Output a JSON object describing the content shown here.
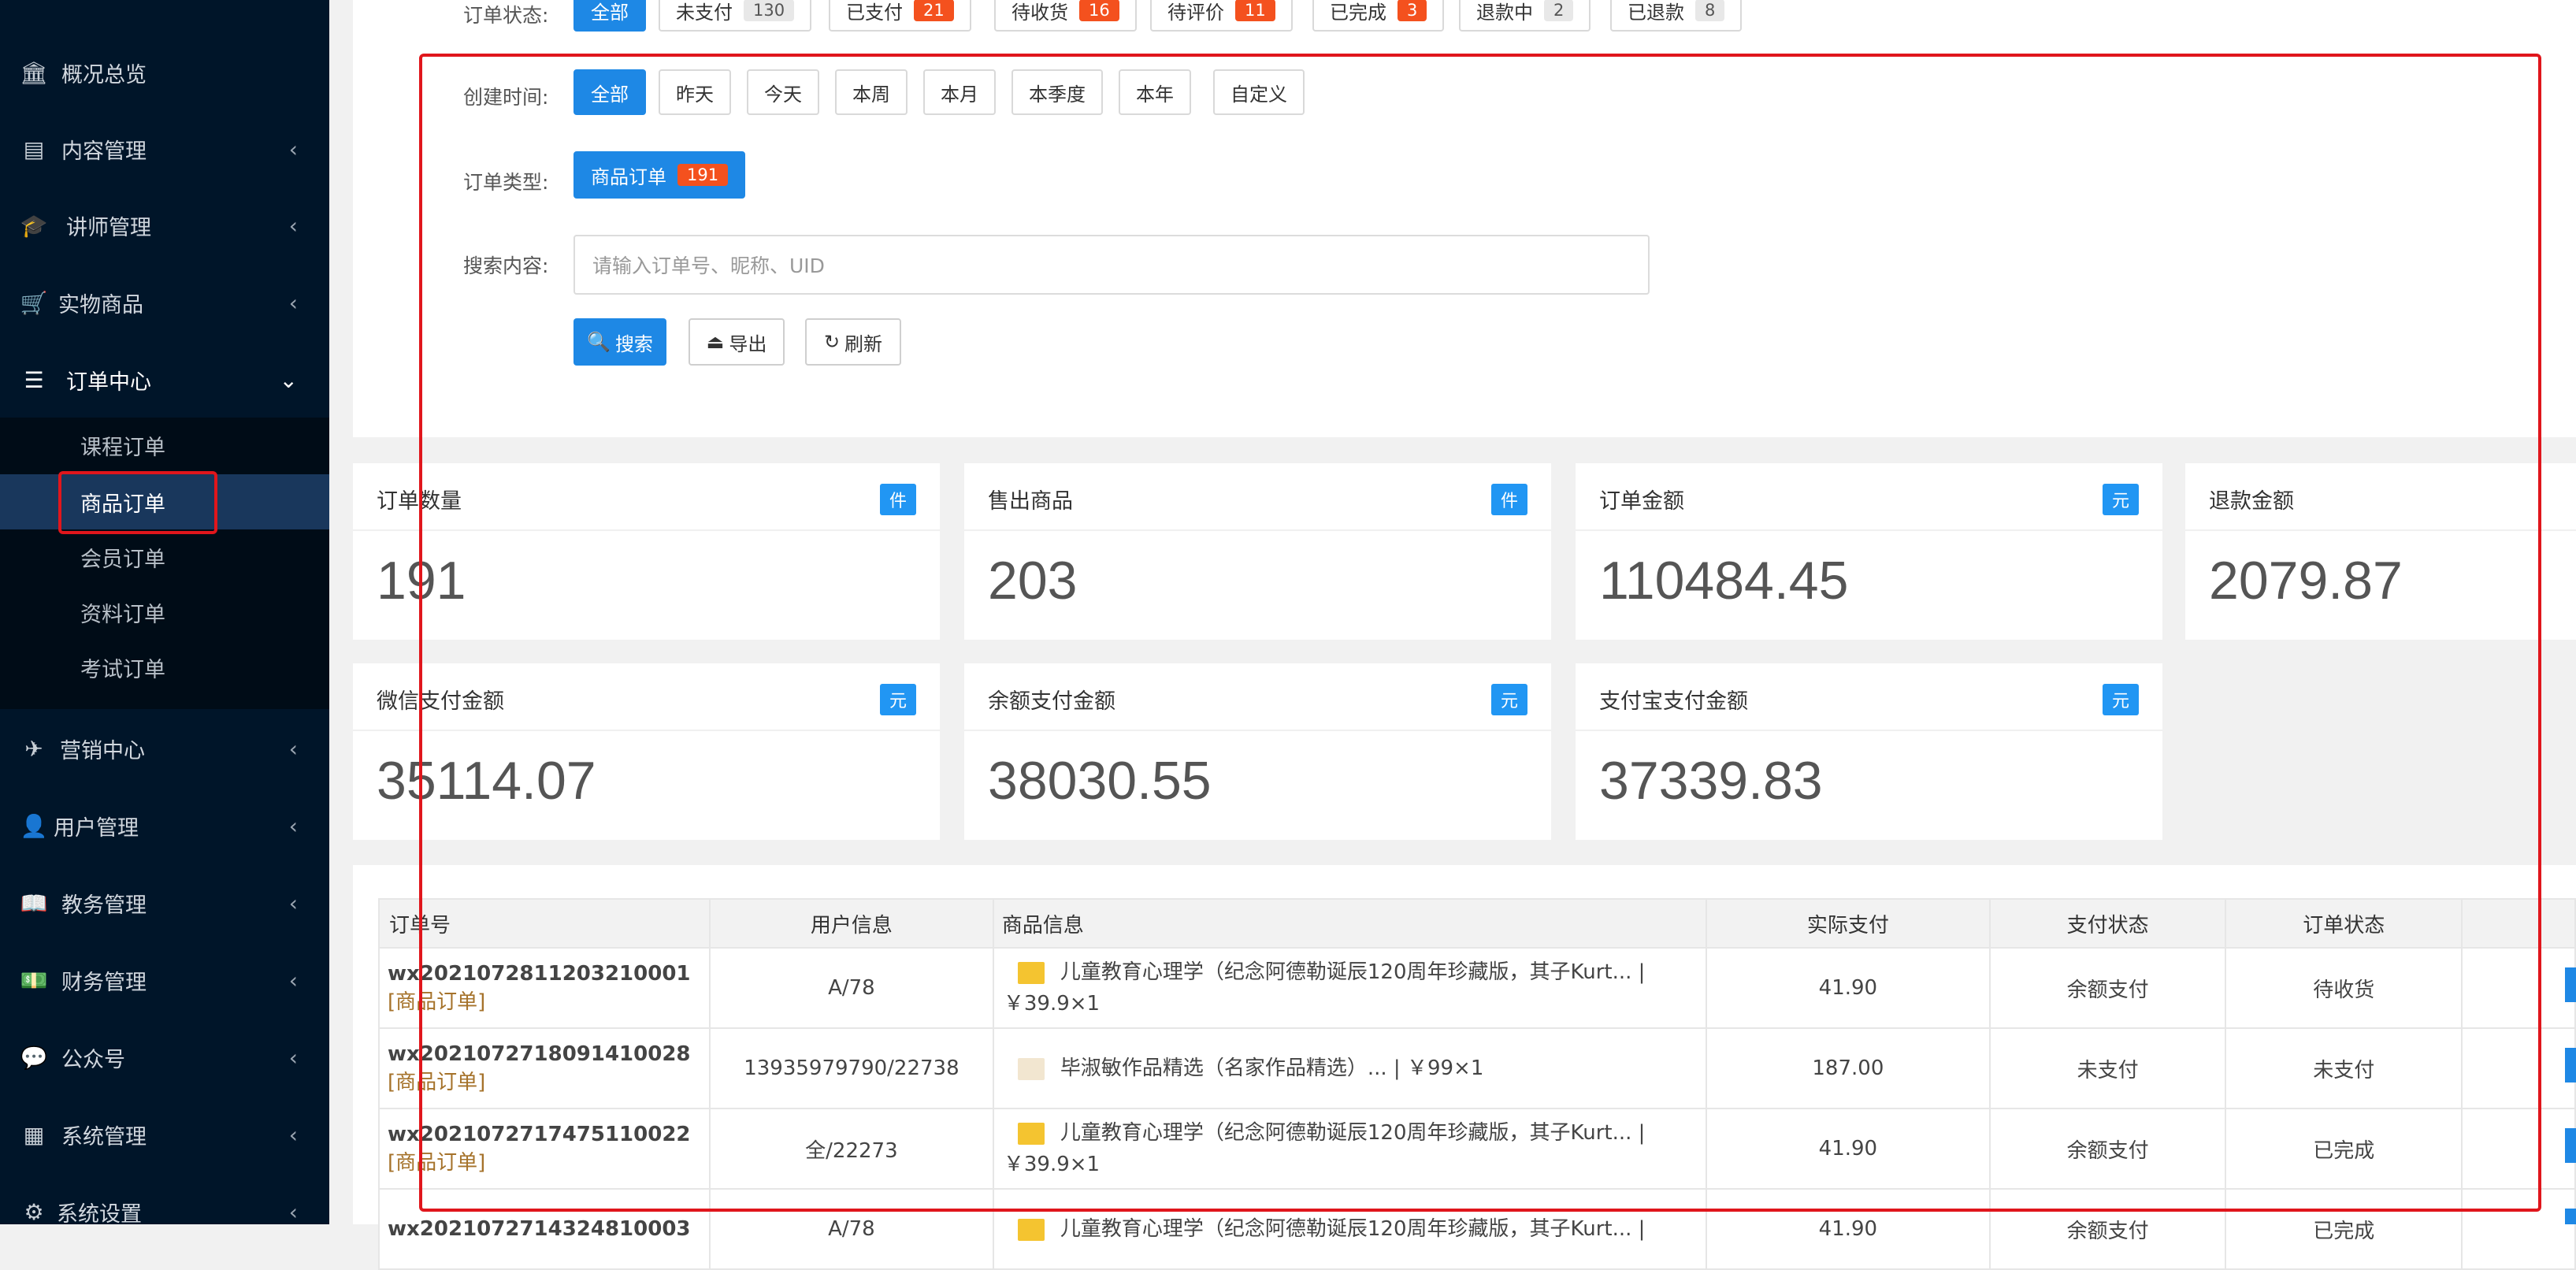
{
  "sidebar": {
    "items": [
      {
        "icon": "bank-icon",
        "label": "概况总览",
        "chevron": ""
      },
      {
        "icon": "newspaper-icon",
        "label": "内容管理",
        "chevron": "‹"
      },
      {
        "icon": "graduation-cap-icon",
        "label": "讲师管理",
        "chevron": "‹"
      },
      {
        "icon": "cart-icon",
        "label": "实物商品",
        "chevron": "‹"
      },
      {
        "icon": "list-icon",
        "label": "订单中心",
        "chevron": "⌄"
      },
      {
        "icon": "paper-plane-icon",
        "label": "营销中心",
        "chevron": "‹"
      },
      {
        "icon": "user-icon",
        "label": "用户管理",
        "chevron": "‹"
      },
      {
        "icon": "book-icon",
        "label": "教务管理",
        "chevron": "‹"
      },
      {
        "icon": "money-icon",
        "label": "财务管理",
        "chevron": "‹"
      },
      {
        "icon": "wechat-icon",
        "label": "公众号",
        "chevron": "‹"
      },
      {
        "icon": "grid-icon",
        "label": "系统管理",
        "chevron": "‹"
      },
      {
        "icon": "gear-icon",
        "label": "系统设置",
        "chevron": "‹"
      }
    ],
    "subitems": [
      "课程订单",
      "商品订单",
      "会员订单",
      "资料订单",
      "考试订单"
    ]
  },
  "filters": {
    "status_label": "订单状态:",
    "status": [
      {
        "label": "全部",
        "count": ""
      },
      {
        "label": "未支付",
        "count": "130"
      },
      {
        "label": "已支付",
        "count": "21"
      },
      {
        "label": "待收货",
        "count": "16"
      },
      {
        "label": "待评价",
        "count": "11"
      },
      {
        "label": "已完成",
        "count": "3"
      },
      {
        "label": "退款中",
        "count": "2"
      },
      {
        "label": "已退款",
        "count": "8"
      }
    ],
    "time_label": "创建时间:",
    "time": [
      "全部",
      "昨天",
      "今天",
      "本周",
      "本月",
      "本季度",
      "本年",
      "自定义"
    ],
    "type_label": "订单类型:",
    "type": {
      "label": "商品订单",
      "count": "191"
    },
    "search_label": "搜索内容:",
    "search_placeholder": "请输入订单号、昵称、UID",
    "buttons": {
      "search": "搜索",
      "export": "导出",
      "refresh": "刷新"
    }
  },
  "stats": [
    {
      "title": "订单数量",
      "unit": "件",
      "value": "191"
    },
    {
      "title": "售出商品",
      "unit": "件",
      "value": "203"
    },
    {
      "title": "订单金额",
      "unit": "元",
      "value": "110484.45"
    },
    {
      "title": "退款金额",
      "unit": "",
      "value": "2079.87"
    },
    {
      "title": "微信支付金额",
      "unit": "元",
      "value": "35114.07"
    },
    {
      "title": "余额支付金额",
      "unit": "元",
      "value": "38030.55"
    },
    {
      "title": "支付宝支付金额",
      "unit": "元",
      "value": "37339.83"
    }
  ],
  "table": {
    "headers": [
      "订单号",
      "用户信息",
      "商品信息",
      "实际支付",
      "支付状态",
      "订单状态"
    ],
    "rows": [
      {
        "order": "wx2021072811203210001",
        "tag": "[商品订单]",
        "user": "A/78",
        "goods1": "儿童教育心理学（纪念阿德勒诞辰120周年珍藏版，其子Kurt... |",
        "goods2": "￥39.9×1",
        "paid": "41.90",
        "pay_status": "余额支付",
        "order_status": "待收货"
      },
      {
        "order": "wx2021072718091410028",
        "tag": "[商品订单]",
        "user": "13935979790/22738",
        "goods1": "毕淑敏作品精选（名家作品精选）... | ￥99×1",
        "goods2": "",
        "paid": "187.00",
        "pay_status": "未支付",
        "order_status": "未支付"
      },
      {
        "order": "wx2021072717475110022",
        "tag": "[商品订单]",
        "user": "全/22273",
        "goods1": "儿童教育心理学（纪念阿德勒诞辰120周年珍藏版，其子Kurt... |",
        "goods2": "￥39.9×1",
        "paid": "41.90",
        "pay_status": "余额支付",
        "order_status": "已完成"
      },
      {
        "order": "wx2021072714324810003",
        "tag": "",
        "user": "A/78",
        "goods1": "儿童教育心理学（纪念阿德勒诞辰120周年珍藏版，其子Kurt... |",
        "goods2": "",
        "paid": "41.90",
        "pay_status": "余额支付",
        "order_status": "已完成"
      }
    ]
  },
  "colors": {
    "sidebar_bg": "#001529",
    "primary": "#1e88e5",
    "badge_red": "#f4511e",
    "highlight": "#e0161c"
  }
}
